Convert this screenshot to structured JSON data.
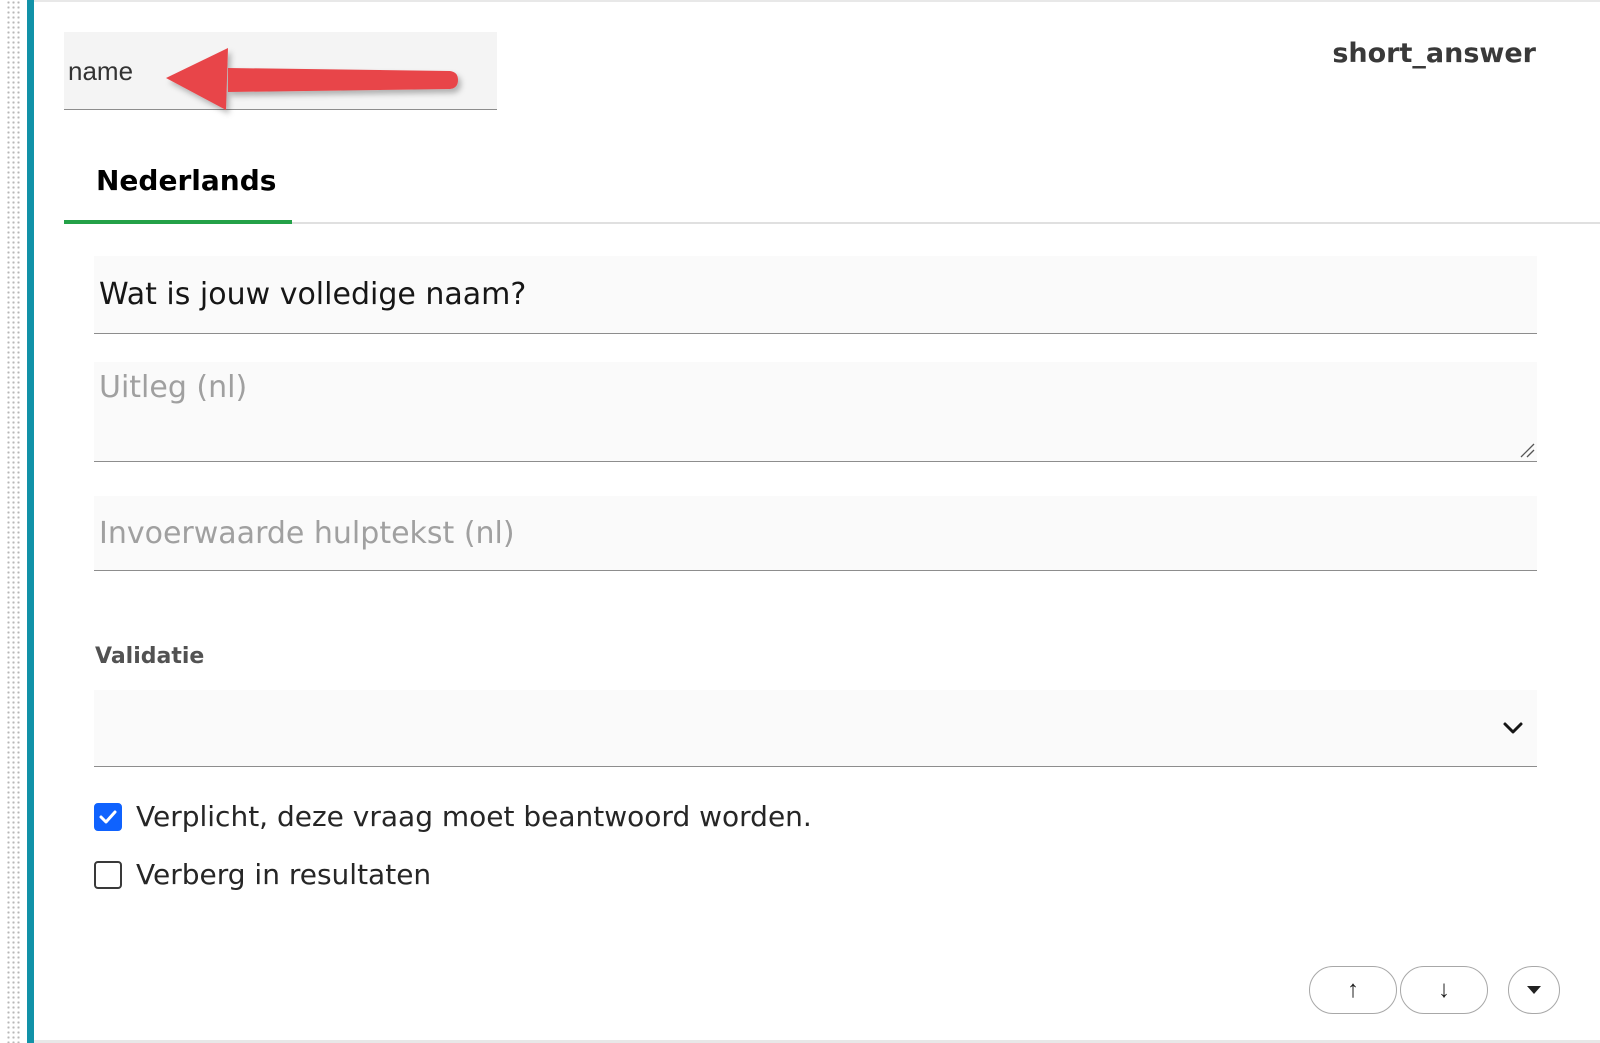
{
  "question": {
    "name_field_value": "name",
    "type_label": "short_answer"
  },
  "tabs": [
    {
      "label": "Nederlands",
      "active": true
    }
  ],
  "fields": {
    "question_value": "Wat is jouw volledige naam?",
    "explanation_placeholder": "Uitleg (nl)",
    "helptext_placeholder": "Invoerwaarde hulptekst (nl)"
  },
  "validation": {
    "label": "Validatie",
    "selected_value": ""
  },
  "checkboxes": {
    "required_label": "Verplicht, deze vraag moet beantwoord worden.",
    "required_checked": true,
    "hide_label": "Verberg in resultaten",
    "hide_checked": false
  },
  "actions": {
    "move_up_icon": "↑",
    "move_down_icon": "↓",
    "menu_icon": "caret-down-icon"
  },
  "colors": {
    "accent": "#1192a8",
    "tab_active": "#24a148",
    "checkbox": "#0f62fe",
    "annotation_arrow": "#e8454a"
  },
  "annotation": {
    "arrow_pointing_to": "name"
  }
}
